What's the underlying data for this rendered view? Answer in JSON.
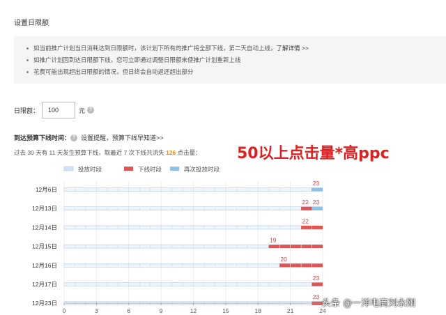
{
  "page": {
    "title": "设置日限额",
    "notices": [
      "如当前推广计划当日消耗达到日限额时，该计划下所有的推广将全部下线，第二天自动上线，",
      "如推广计划因到达日限额下线，您可立即通过调整日限额来使推广计划重新上线",
      "花费可能出现超出日限额的情况，但日终会自动返还超出部分"
    ],
    "notice_link": "了解详情 >>",
    "limit_label": "日限额：",
    "limit_value": "100",
    "limit_unit": "元",
    "help_icon": "question-circle-icon",
    "reach_label": "到达预算下线时间：",
    "reach_remind": "设置提醒，预算下线早知道>>",
    "stat_prefix": "过去 30 天有 11 天发生预算下线，取最近 7 次下线共流失",
    "stat_number": "126",
    "stat_suffix": "点击量：",
    "overlay_text": "50以上点击量*高ppc",
    "watermark": "头条 @一洋电商刘永刚"
  },
  "colors": {
    "active": "#cfe3f5",
    "offline": "#e05454",
    "reactive": "#8ec2ea",
    "label_red": "#d64040",
    "stat_orange": "#e08a1e"
  },
  "chart_data": {
    "type": "bar",
    "legend": [
      "投放时段",
      "下线时段",
      "再次投放时段"
    ],
    "x_ticks": [
      "0",
      "3",
      "6",
      "9",
      "12",
      "15",
      "18",
      "21",
      "24"
    ],
    "xlim": [
      0,
      24
    ],
    "rows": [
      {
        "date": "12月6日",
        "offline": [
          [
            23,
            24
          ]
        ],
        "reactive": [
          [
            23,
            24
          ]
        ],
        "labels": [
          "23"
        ]
      },
      {
        "date": "12月13日",
        "offline": [
          [
            22,
            23
          ]
        ],
        "reactive": [
          [
            23,
            24
          ]
        ],
        "labels": [
          "22",
          "23"
        ]
      },
      {
        "date": "12月14日",
        "offline": [
          [
            22,
            24
          ]
        ],
        "reactive": [],
        "labels": [
          "22"
        ]
      },
      {
        "date": "12月15日",
        "offline": [
          [
            19,
            24
          ]
        ],
        "reactive": [],
        "labels": [
          "19"
        ]
      },
      {
        "date": "12月16日",
        "offline": [
          [
            20,
            24
          ]
        ],
        "reactive": [],
        "labels": [
          "20"
        ]
      },
      {
        "date": "12月17日",
        "offline": [
          [
            23,
            24
          ]
        ],
        "reactive": [],
        "labels": [
          "23"
        ]
      },
      {
        "date": "12月23日",
        "offline": [
          [
            23,
            24
          ]
        ],
        "reactive": [],
        "labels": [
          "23"
        ]
      }
    ]
  }
}
